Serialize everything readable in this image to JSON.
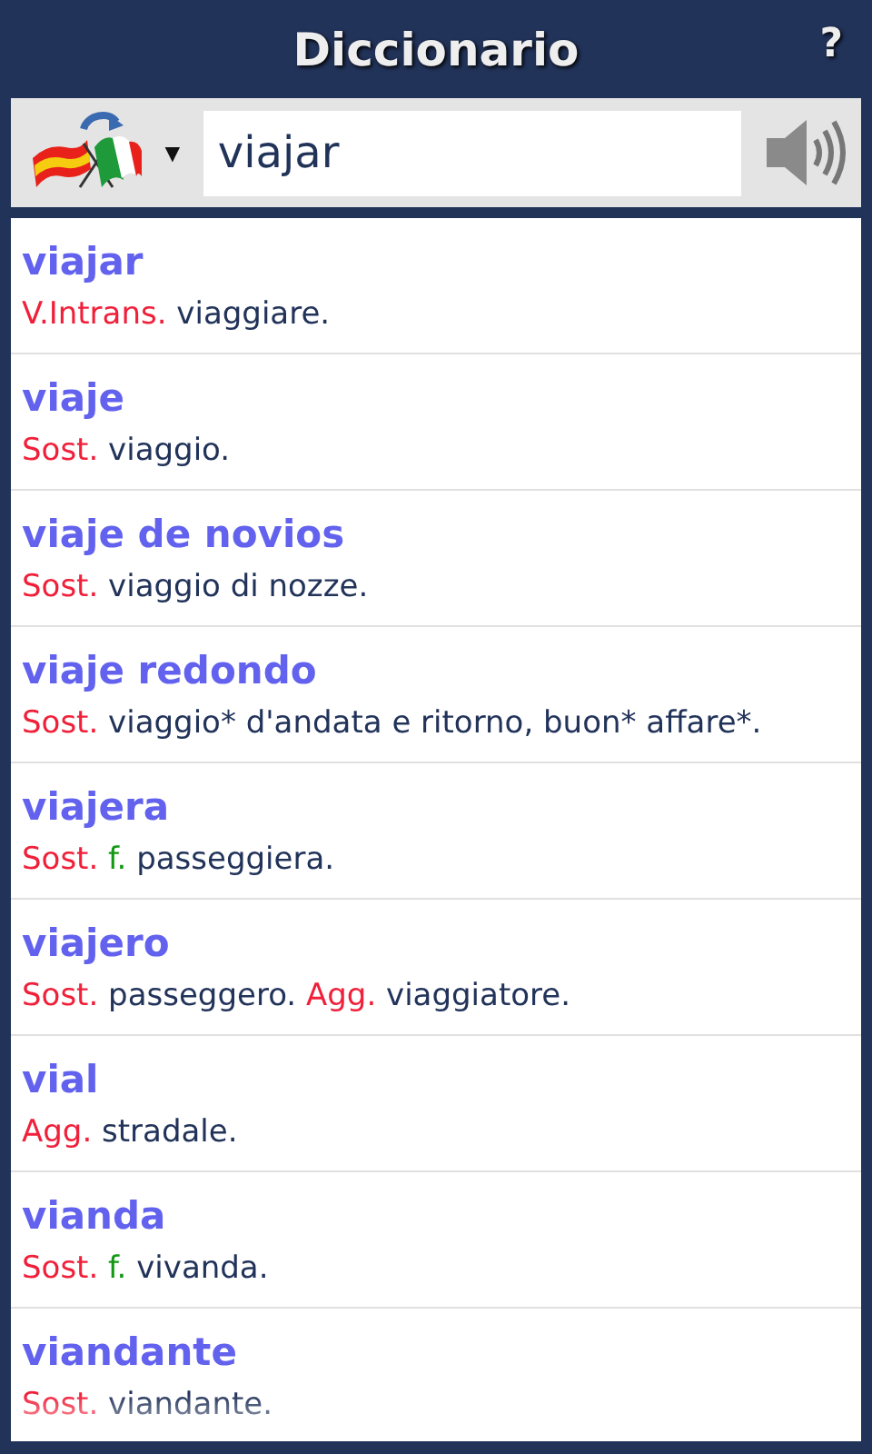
{
  "header": {
    "title": "Diccionario",
    "help": "?"
  },
  "search": {
    "language_menu": "▼",
    "value": "viajar"
  },
  "entries": [
    {
      "word": "viajar",
      "definition": [
        {
          "kind": "pos",
          "text": "V.Intrans."
        },
        {
          "kind": "text",
          "text": "viaggiare."
        }
      ]
    },
    {
      "word": "viaje",
      "definition": [
        {
          "kind": "pos",
          "text": "Sost."
        },
        {
          "kind": "text",
          "text": "viaggio."
        }
      ]
    },
    {
      "word": "viaje de novios",
      "definition": [
        {
          "kind": "pos",
          "text": "Sost."
        },
        {
          "kind": "text",
          "text": "viaggio di nozze."
        }
      ]
    },
    {
      "word": "viaje redondo",
      "definition": [
        {
          "kind": "pos",
          "text": "Sost."
        },
        {
          "kind": "text",
          "text": "viaggio* d'andata e ritorno, buon* affare*."
        }
      ]
    },
    {
      "word": "viajera",
      "definition": [
        {
          "kind": "pos",
          "text": "Sost."
        },
        {
          "kind": "gender",
          "text": "f."
        },
        {
          "kind": "text",
          "text": "passeggiera."
        }
      ]
    },
    {
      "word": "viajero",
      "definition": [
        {
          "kind": "pos",
          "text": "Sost."
        },
        {
          "kind": "text",
          "text": "passeggero."
        },
        {
          "kind": "pos",
          "text": "Agg."
        },
        {
          "kind": "text",
          "text": "viaggiatore."
        }
      ]
    },
    {
      "word": "vial",
      "definition": [
        {
          "kind": "pos",
          "text": "Agg."
        },
        {
          "kind": "text",
          "text": "stradale."
        }
      ]
    },
    {
      "word": "vianda",
      "definition": [
        {
          "kind": "pos",
          "text": "Sost."
        },
        {
          "kind": "gender",
          "text": "f."
        },
        {
          "kind": "text",
          "text": "vivanda."
        }
      ]
    },
    {
      "word": "viandante",
      "definition": [
        {
          "kind": "pos",
          "text": "Sost."
        },
        {
          "kind": "text",
          "text": "viandante."
        }
      ]
    }
  ]
}
